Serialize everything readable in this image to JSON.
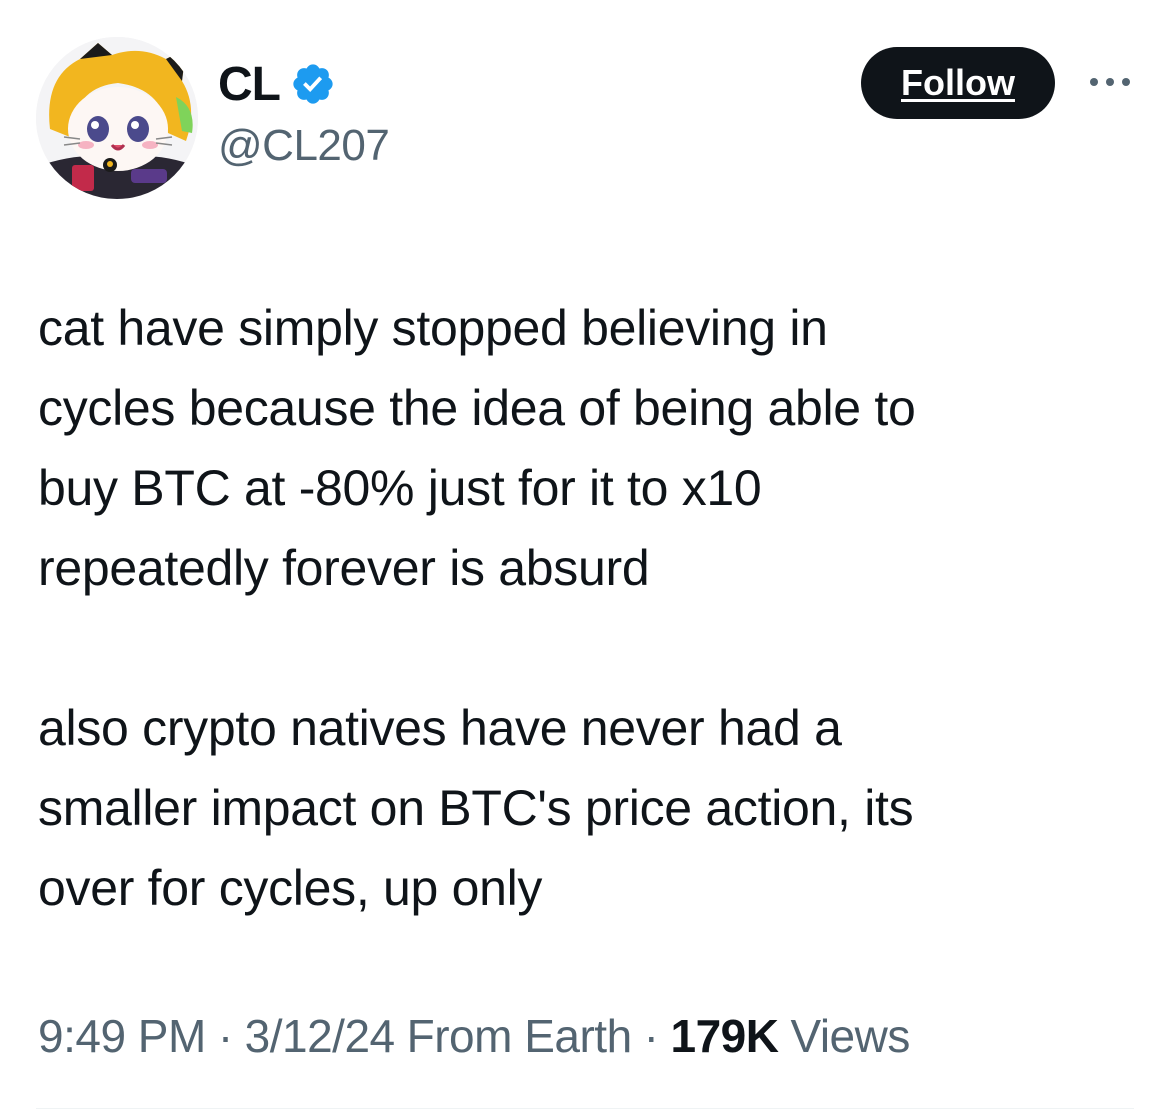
{
  "author": {
    "display_name": "CL",
    "handle": "@CL207",
    "verified": true,
    "verified_color": "#1d9bf0"
  },
  "actions": {
    "follow_label": "Follow"
  },
  "tweet": {
    "paragraphs": [
      "cat have simply stopped believing in\ncycles because the idea of being able to\nbuy BTC at -80% just for it to x10\nrepeatedly forever is absurd",
      "also crypto natives have never had a\nsmaller impact on BTC's price action, its\nover for cycles, up only"
    ]
  },
  "meta": {
    "time": "9:49 PM",
    "separator": "·",
    "date": "3/12/24",
    "location": "From Earth",
    "views_count": "179K",
    "views_label": "Views"
  },
  "colors": {
    "text_primary": "#0f1419",
    "text_secondary": "#536471",
    "follow_bg": "#0f1419",
    "avatar_hood": "#f2b61f"
  },
  "icons": {
    "avatar": "anime-cat-in-yellow-hood",
    "verified": "verified-badge-icon",
    "more": "more-horizontal-icon"
  }
}
